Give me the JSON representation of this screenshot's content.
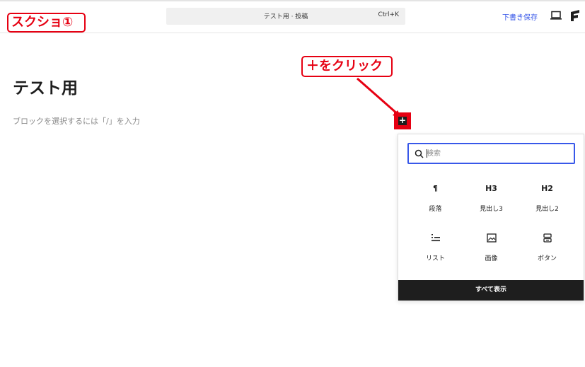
{
  "header": {
    "command_title": "テスト用 · 投稿",
    "command_shortcut": "Ctrl+K",
    "save_draft": "下書き保存",
    "preview_icon": "desktop-preview-icon",
    "brand_icon": "site-logo-icon"
  },
  "annotations": {
    "screenshot_label": "スクショ①",
    "click_label": "＋をクリック",
    "color": "#e60012"
  },
  "editor": {
    "post_title": "テスト用",
    "block_placeholder": "ブロックを選択するには「/」を入力",
    "inserter_symbol": "+"
  },
  "inserter": {
    "search_placeholder": "検索",
    "blocks": [
      {
        "icon_text": "¶",
        "label": "段落",
        "icon": "paragraph-icon"
      },
      {
        "icon_text": "H3",
        "label": "見出し3",
        "icon": "heading-3-icon"
      },
      {
        "icon_text": "H2",
        "label": "見出し2",
        "icon": "heading-2-icon"
      },
      {
        "icon_text": "",
        "label": "リスト",
        "icon": "list-icon"
      },
      {
        "icon_text": "",
        "label": "画像",
        "icon": "image-icon"
      },
      {
        "icon_text": "",
        "label": "ボタン",
        "icon": "buttons-icon"
      }
    ],
    "show_all": "すべて表示"
  },
  "colors": {
    "accent": "#3858e9",
    "dark": "#1e1e1e",
    "annotation": "#e60012"
  }
}
